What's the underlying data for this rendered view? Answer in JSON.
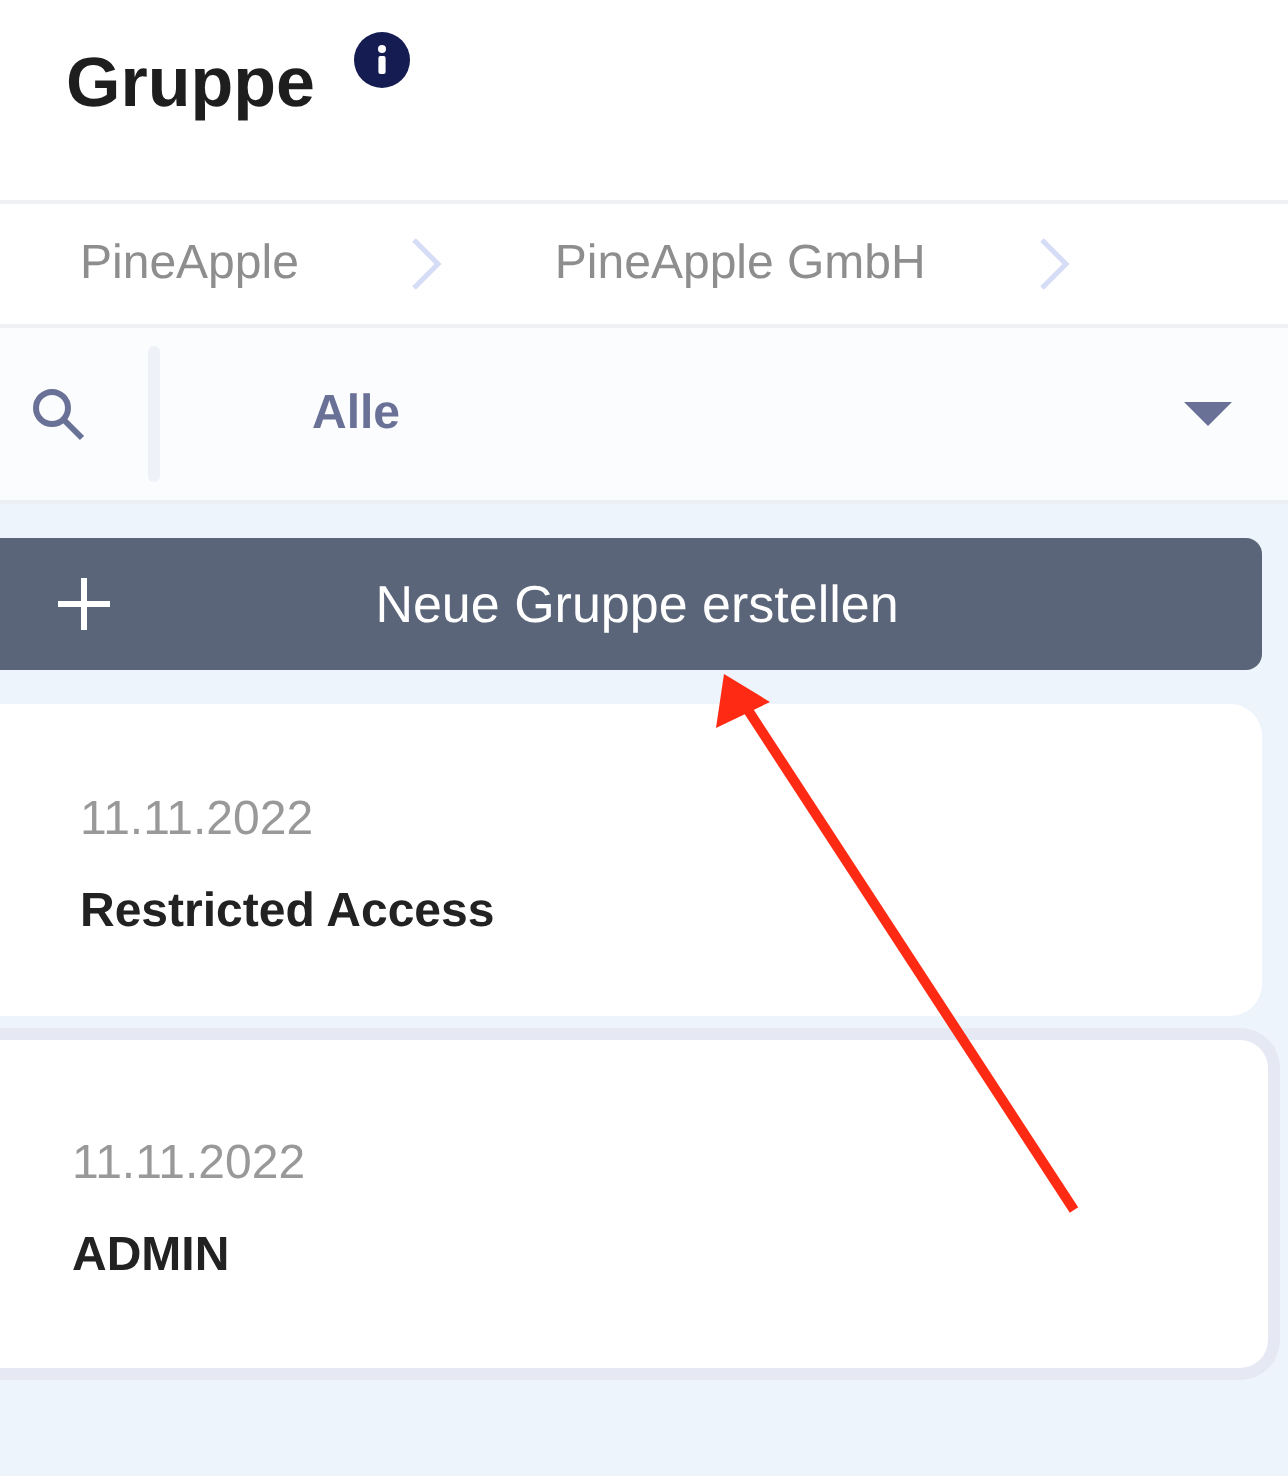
{
  "header": {
    "title": "Gruppe"
  },
  "breadcrumb": [
    {
      "label": "PineApple"
    },
    {
      "label": "PineApple GmbH"
    }
  ],
  "filter": {
    "value": "Alle"
  },
  "create_button": {
    "label": "Neue Gruppe erstellen"
  },
  "groups": [
    {
      "date": "11.11.2022",
      "name": "Restricted Access",
      "selected": false
    },
    {
      "date": "11.11.2022",
      "name": "ADMIN",
      "selected": true
    }
  ]
}
